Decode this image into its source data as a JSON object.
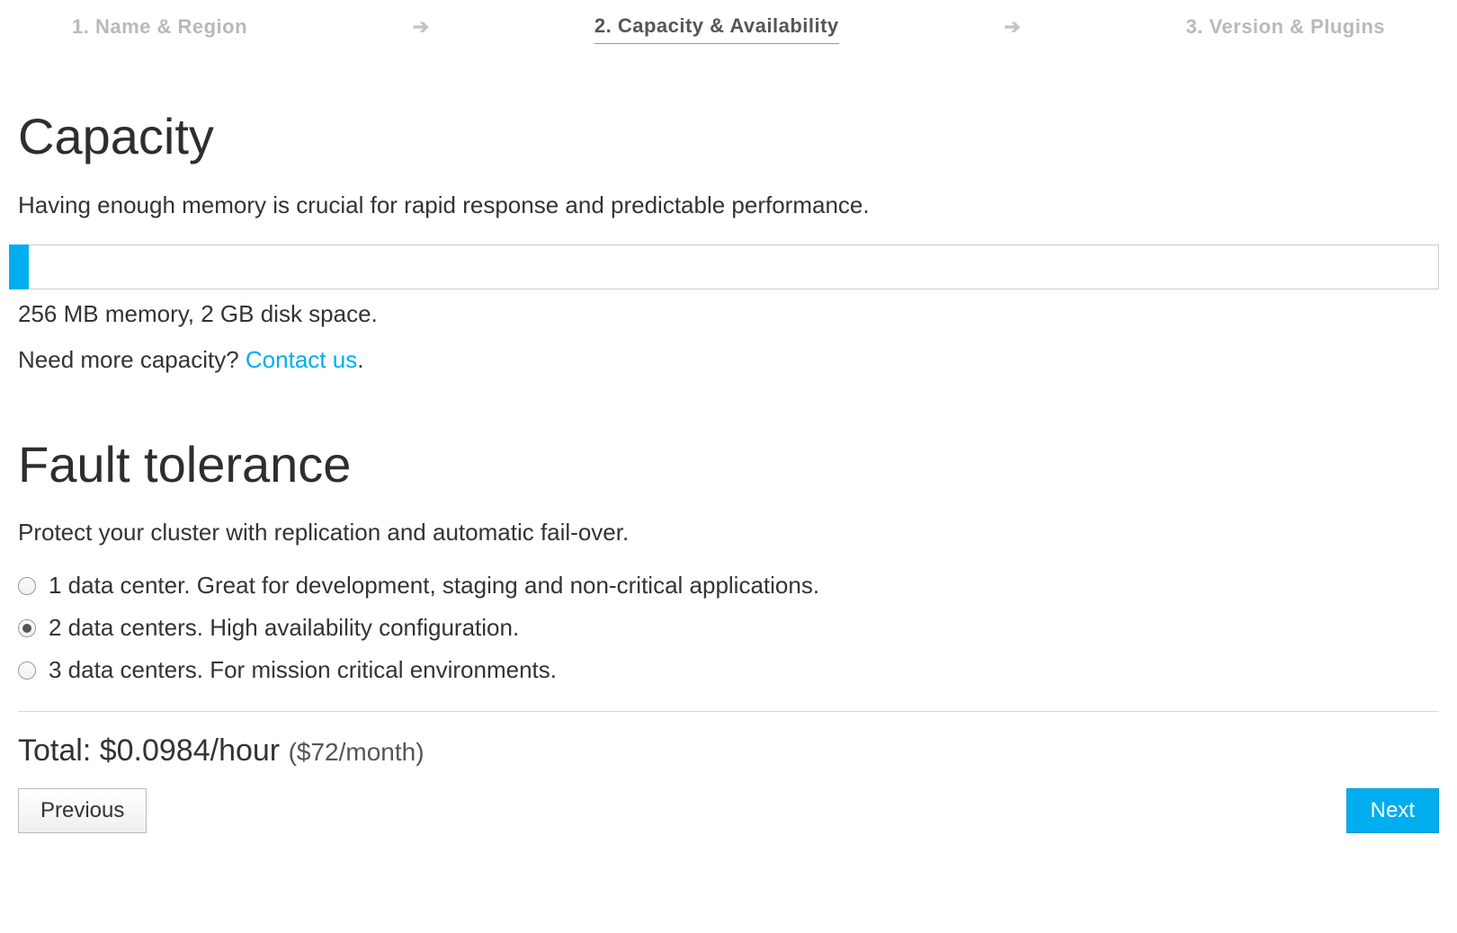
{
  "wizard": {
    "steps": [
      {
        "label": "1. Name & Region"
      },
      {
        "label": "2. Capacity & Availability"
      },
      {
        "label": "3. Version & Plugins"
      }
    ],
    "active_index": 1
  },
  "capacity": {
    "heading": "Capacity",
    "description": "Having enough memory is crucial for rapid response and predictable performance.",
    "selected_value": "256 MB memory, 2 GB disk space.",
    "more_prefix": "Need more capacity? ",
    "more_link": "Contact us",
    "more_suffix": "."
  },
  "fault_tolerance": {
    "heading": "Fault tolerance",
    "description": "Protect your cluster with replication and automatic fail-over.",
    "options": [
      {
        "label": "1 data center. Great for development, staging and non-critical applications.",
        "selected": false
      },
      {
        "label": "2 data centers. High availability configuration.",
        "selected": true
      },
      {
        "label": "3 data centers. For mission critical environments.",
        "selected": false
      }
    ]
  },
  "total": {
    "prefix": "Total: ",
    "hourly": "$0.0984/hour",
    "monthly": "($72/month)"
  },
  "buttons": {
    "previous": "Previous",
    "next": "Next"
  }
}
